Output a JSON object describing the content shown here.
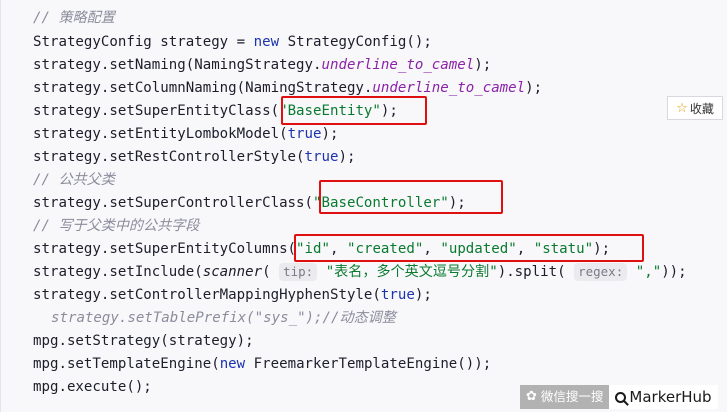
{
  "lines": {
    "l1": "// 策略配置",
    "l2_a": "StrategyConfig strategy = ",
    "l2_kw": "new",
    "l2_b": " StrategyConfig();",
    "l3_a": "strategy.setNaming(NamingStrategy.",
    "l3_f": "underline_to_camel",
    "l3_b": ");",
    "l4_a": "strategy.setColumnNaming(NamingStrategy.",
    "l4_f": "underline_to_camel",
    "l4_b": ");",
    "l5_a": "strategy.setSuperEntityClass(",
    "l5_s": "\"BaseEntity\"",
    "l5_b": ");",
    "l6_a": "strategy.setEntityLombokModel(",
    "l6_kw": "true",
    "l6_b": ");",
    "l7_a": "strategy.setRestControllerStyle(",
    "l7_kw": "true",
    "l7_b": ");",
    "l8": "// 公共父类",
    "l9_a": "strategy.setSuperControllerClass(",
    "l9_s": "\"BaseController\"",
    "l9_b": ");",
    "l10": "// 写于父类中的公共字段",
    "l11_a": "strategy.setSuperEntityColumns(",
    "l11_s1": "\"id\"",
    "l11_c1": ", ",
    "l11_s2": "\"created\"",
    "l11_c2": ", ",
    "l11_s3": "\"updated\"",
    "l11_c3": ", ",
    "l11_s4": "\"statu\"",
    "l11_b": ");",
    "l12_a": "strategy.setInclude(",
    "l12_fn": "scanner",
    "l12_p": "( ",
    "l12_hint1": "tip:",
    "l12_s": " \"表名，多个英文逗号分割\"",
    "l12_m": ").split( ",
    "l12_hint2": "regex:",
    "l12_s2": " \",\"",
    "l12_b": "));",
    "l13_a": "strategy.setControllerMappingHyphenStyle(",
    "l13_kw": "true",
    "l13_b": ");",
    "l14": "strategy.setTablePrefix(\"sys_\");//动态调整",
    "l15": "mpg.setStrategy(strategy);",
    "l16_a": "mpg.setTemplateEngine(",
    "l16_kw": "new",
    "l16_b": " FreemarkerTemplateEngine());",
    "l17": "mpg.execute();"
  },
  "favorite_button": {
    "label": "收藏",
    "icon": "star-icon"
  },
  "watermark": {
    "text": "微信搜一搜",
    "brand": "MarkerHub",
    "icon": "wechat-icon"
  },
  "colors": {
    "highlight_box": "#e01010",
    "keyword": "#1c33ad",
    "string": "#0a7a2e",
    "static_field": "#8a23a6",
    "comment": "#8c8c9c"
  }
}
